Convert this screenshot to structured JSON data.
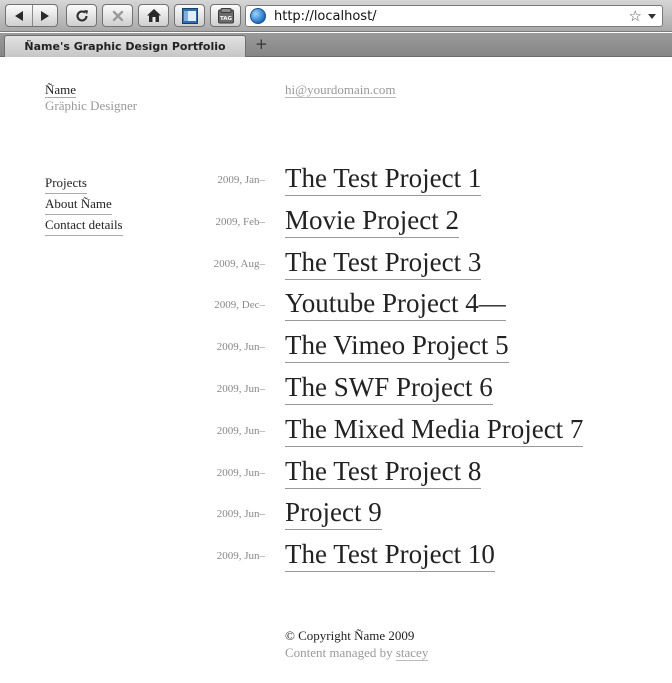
{
  "browser": {
    "url": "http://localhost/",
    "tab_title": "Ñame's Graphic Design Portfolio",
    "new_tab": "+",
    "tag_label": "TAG"
  },
  "header": {
    "name": "Ñame",
    "role": "Gräphic Designer",
    "email": "hi@yourdomain.com"
  },
  "nav": {
    "items": [
      {
        "label": "Projects"
      },
      {
        "label": "About Ñame"
      },
      {
        "label": "Contact details"
      }
    ]
  },
  "projects": [
    {
      "date": "2009, Jan–",
      "title": "The Test Project 1"
    },
    {
      "date": "2009, Feb–",
      "title": "Movie Project 2"
    },
    {
      "date": "2009, Aug–",
      "title": "The Test Project 3"
    },
    {
      "date": "2009, Dec–",
      "title": "Youtube Project 4—"
    },
    {
      "date": "2009, Jun–",
      "title": "The Vimeo Project 5"
    },
    {
      "date": "2009, Jun–",
      "title": "The SWF Project 6"
    },
    {
      "date": "2009, Jun–",
      "title": "The Mixed Media Project 7"
    },
    {
      "date": "2009, Jun–",
      "title": "The Test Project 8"
    },
    {
      "date": "2009, Jun–",
      "title": "Project 9"
    },
    {
      "date": "2009, Jun–",
      "title": "The Test Project 10"
    }
  ],
  "footer": {
    "copyright": "© Copyright Ñame 2009",
    "managed_prefix": "Content managed by ",
    "managed_link": "stacey"
  },
  "icons": {
    "back": "back-arrow-icon",
    "forward": "forward-arrow-icon",
    "reload": "reload-icon",
    "stop": "stop-icon",
    "home": "home-icon",
    "page": "page-icon",
    "tag": "tag-icon",
    "site": "globe-icon",
    "bookmark": "star-icon"
  }
}
